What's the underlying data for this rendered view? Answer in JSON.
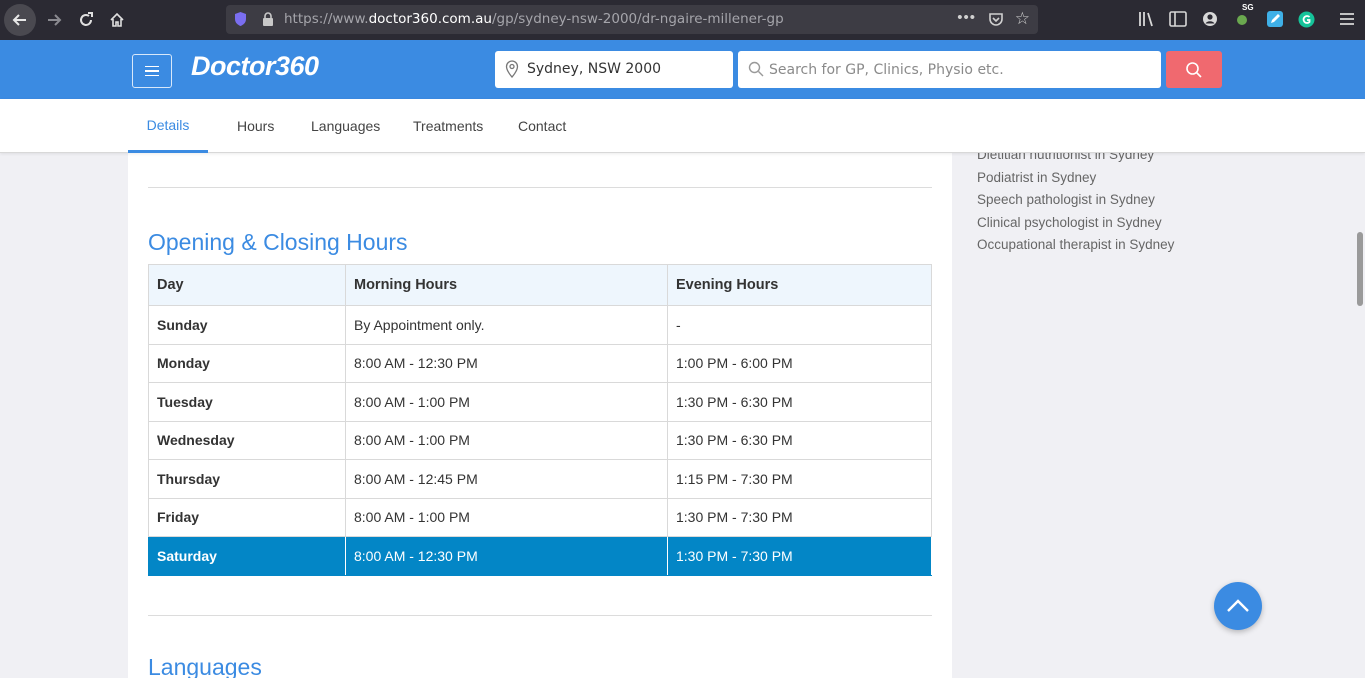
{
  "browser": {
    "url_prefix": "https://www.",
    "url_host": "doctor360.com.au",
    "url_path": "/gp/sydney-nsw-2000/dr-ngaire-millener-gp",
    "ext_badge": "SG"
  },
  "header": {
    "logo": "Doctor360",
    "location": "Sydney, NSW 2000",
    "search_placeholder": "Search for GP, Clinics, Physio etc."
  },
  "tabs": [
    "Details",
    "Hours",
    "Languages",
    "Treatments",
    "Contact"
  ],
  "hours_section": {
    "title": "Opening & Closing Hours",
    "columns": [
      "Day",
      "Morning Hours",
      "Evening Hours"
    ],
    "rows": [
      {
        "day": "Sunday",
        "morning": "By Appointment only.",
        "evening": "-"
      },
      {
        "day": "Monday",
        "morning": "8:00 AM - 12:30 PM",
        "evening": "1:00 PM - 6:00 PM"
      },
      {
        "day": "Tuesday",
        "morning": "8:00 AM - 1:00 PM",
        "evening": "1:30 PM - 6:30 PM"
      },
      {
        "day": "Wednesday",
        "morning": "8:00 AM - 1:00 PM",
        "evening": "1:30 PM - 6:30 PM"
      },
      {
        "day": "Thursday",
        "morning": "8:00 AM - 12:45 PM",
        "evening": "1:15 PM - 7:30 PM"
      },
      {
        "day": "Friday",
        "morning": "8:00 AM - 1:00 PM",
        "evening": "1:30 PM - 7:30 PM"
      },
      {
        "day": "Saturday",
        "morning": "8:00 AM - 12:30 PM",
        "evening": "1:30 PM - 7:30 PM"
      }
    ],
    "highlighted_day": "Saturday"
  },
  "languages_section": {
    "title": "Languages"
  },
  "sidebar": {
    "links": [
      "Dietitian nutritionist in Sydney",
      "Podiatrist in Sydney",
      "Speech pathologist in Sydney",
      "Clinical psychologist in Sydney",
      "Occupational therapist in Sydney"
    ]
  },
  "colors": {
    "brand_blue": "#3b8be2",
    "highlight_row": "#0386c6",
    "search_button": "#f0696f"
  }
}
